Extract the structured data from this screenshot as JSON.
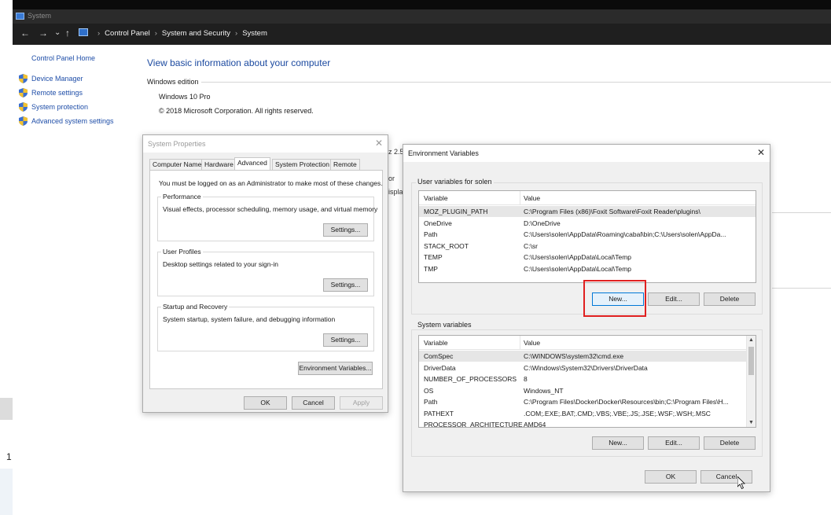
{
  "left_fragment": "1",
  "window": {
    "title": "System"
  },
  "addressbar": {
    "back": "←",
    "forward": "→",
    "recent": "⌄",
    "up": "↑",
    "breadcrumbs": [
      "Control Panel",
      "System and Security",
      "System"
    ],
    "separator": "›"
  },
  "sidebar": {
    "home": "Control Panel Home",
    "items": [
      {
        "label": "Device Manager",
        "icon": "shield-icon"
      },
      {
        "label": "Remote settings",
        "icon": "shield-icon"
      },
      {
        "label": "System protection",
        "icon": "shield-icon"
      },
      {
        "label": "Advanced system settings",
        "icon": "shield-icon"
      }
    ]
  },
  "main": {
    "title": "View basic information about your computer",
    "section": "Windows edition",
    "edition": "Windows 10 Pro",
    "copyright": "© 2018 Microsoft Corporation. All rights reserved.",
    "peek": [
      "z 2.5",
      "or",
      "isplay"
    ]
  },
  "system_properties": {
    "title": "System Properties",
    "close": "✕",
    "tabs": [
      "Computer Name",
      "Hardware",
      "Advanced",
      "System Protection",
      "Remote"
    ],
    "active_tab": "Advanced",
    "note": "You must be logged on as an Administrator to make most of these changes.",
    "groups": [
      {
        "label": "Performance",
        "desc": "Visual effects, processor scheduling, memory usage, and virtual memory",
        "button": "Settings..."
      },
      {
        "label": "User Profiles",
        "desc": "Desktop settings related to your sign-in",
        "button": "Settings..."
      },
      {
        "label": "Startup and Recovery",
        "desc": "System startup, system failure, and debugging information",
        "button": "Settings..."
      }
    ],
    "env_button": "Environment Variables...",
    "ok": "OK",
    "cancel": "Cancel",
    "apply": "Apply"
  },
  "env_vars": {
    "title": "Environment Variables",
    "close": "✕",
    "user_section": "User variables for solen",
    "system_section": "System variables",
    "col_variable": "Variable",
    "col_value": "Value",
    "user_rows": [
      {
        "variable": "MOZ_PLUGIN_PATH",
        "value": "C:\\Program Files (x86)\\Foxit Software\\Foxit Reader\\plugins\\"
      },
      {
        "variable": "OneDrive",
        "value": "D:\\OneDrive"
      },
      {
        "variable": "Path",
        "value": "C:\\Users\\solen\\AppData\\Roaming\\cabal\\bin;C:\\Users\\solen\\AppDa..."
      },
      {
        "variable": "STACK_ROOT",
        "value": "C:\\sr"
      },
      {
        "variable": "TEMP",
        "value": "C:\\Users\\solen\\AppData\\Local\\Temp"
      },
      {
        "variable": "TMP",
        "value": "C:\\Users\\solen\\AppData\\Local\\Temp"
      }
    ],
    "system_rows": [
      {
        "variable": "ComSpec",
        "value": "C:\\WINDOWS\\system32\\cmd.exe"
      },
      {
        "variable": "DriverData",
        "value": "C:\\Windows\\System32\\Drivers\\DriverData"
      },
      {
        "variable": "NUMBER_OF_PROCESSORS",
        "value": "8"
      },
      {
        "variable": "OS",
        "value": "Windows_NT"
      },
      {
        "variable": "Path",
        "value": "C:\\Program Files\\Docker\\Docker\\Resources\\bin;C:\\Program Files\\H..."
      },
      {
        "variable": "PATHEXT",
        "value": ".COM;.EXE;.BAT;.CMD;.VBS;.VBE;.JS;.JSE;.WSF;.WSH;.MSC"
      },
      {
        "variable": "PROCESSOR_ARCHITECTURE",
        "value": "AMD64"
      }
    ],
    "new": "New...",
    "edit": "Edit...",
    "delete": "Delete",
    "ok": "OK",
    "cancel": "Cancel",
    "highlight_color": "#e02020"
  }
}
